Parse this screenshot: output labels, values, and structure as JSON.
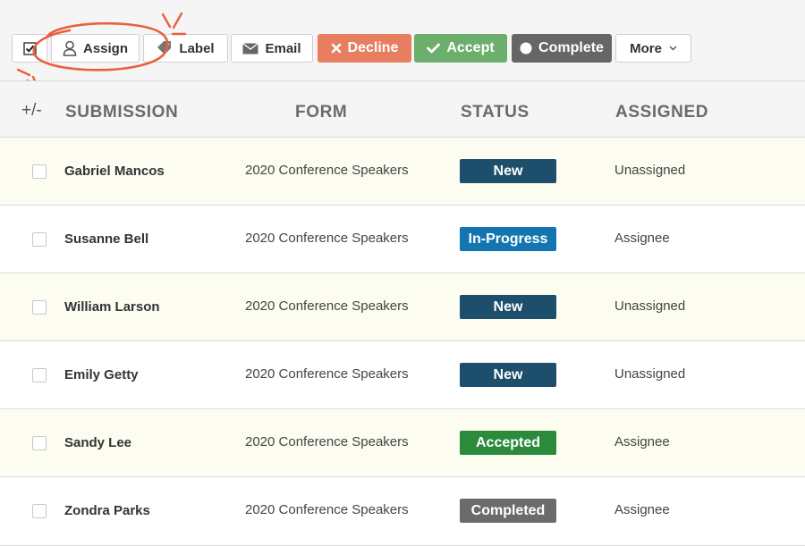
{
  "toolbar": {
    "assign_label": "Assign",
    "label_label": "Label",
    "email_label": "Email",
    "decline_label": "Decline",
    "accept_label": "Accept",
    "complete_label": "Complete",
    "more_label": "More"
  },
  "table": {
    "toggle_label": "+/-",
    "columns": [
      "SUBMISSION",
      "FORM",
      "STATUS",
      "ASSIGNED"
    ],
    "rows": [
      {
        "name": "Gabriel Mancos",
        "form": "2020 Conference Speakers",
        "status": "New",
        "assigned": "Unassigned"
      },
      {
        "name": "Susanne Bell",
        "form": "2020 Conference Speakers",
        "status": "In-Progress",
        "assigned": "Assignee"
      },
      {
        "name": "William Larson",
        "form": "2020 Conference Speakers",
        "status": "New",
        "assigned": "Unassigned"
      },
      {
        "name": "Emily Getty",
        "form": "2020 Conference Speakers",
        "status": "New",
        "assigned": "Unassigned"
      },
      {
        "name": "Sandy Lee",
        "form": "2020 Conference Speakers",
        "status": "Accepted",
        "assigned": "Assignee"
      },
      {
        "name": "Zondra Parks",
        "form": "2020 Conference Speakers",
        "status": "Completed",
        "assigned": "Assignee"
      }
    ]
  },
  "colors": {
    "status_new": "#1d4e6b",
    "status_in_progress": "#1376b1",
    "status_accepted": "#2c8a3d",
    "status_completed": "#6b6b6b",
    "decline": "#e77e5f",
    "accept": "#6cae6c",
    "complete": "#666666",
    "annotation": "#e8613e"
  },
  "icons": {
    "select_all": "checkbox-checked-icon",
    "assign": "user-icon",
    "label": "tag-icon",
    "email": "envelope-icon",
    "decline": "x-icon",
    "accept": "checkmark-icon",
    "complete": "circle-icon",
    "more": "chevron-down-icon"
  }
}
